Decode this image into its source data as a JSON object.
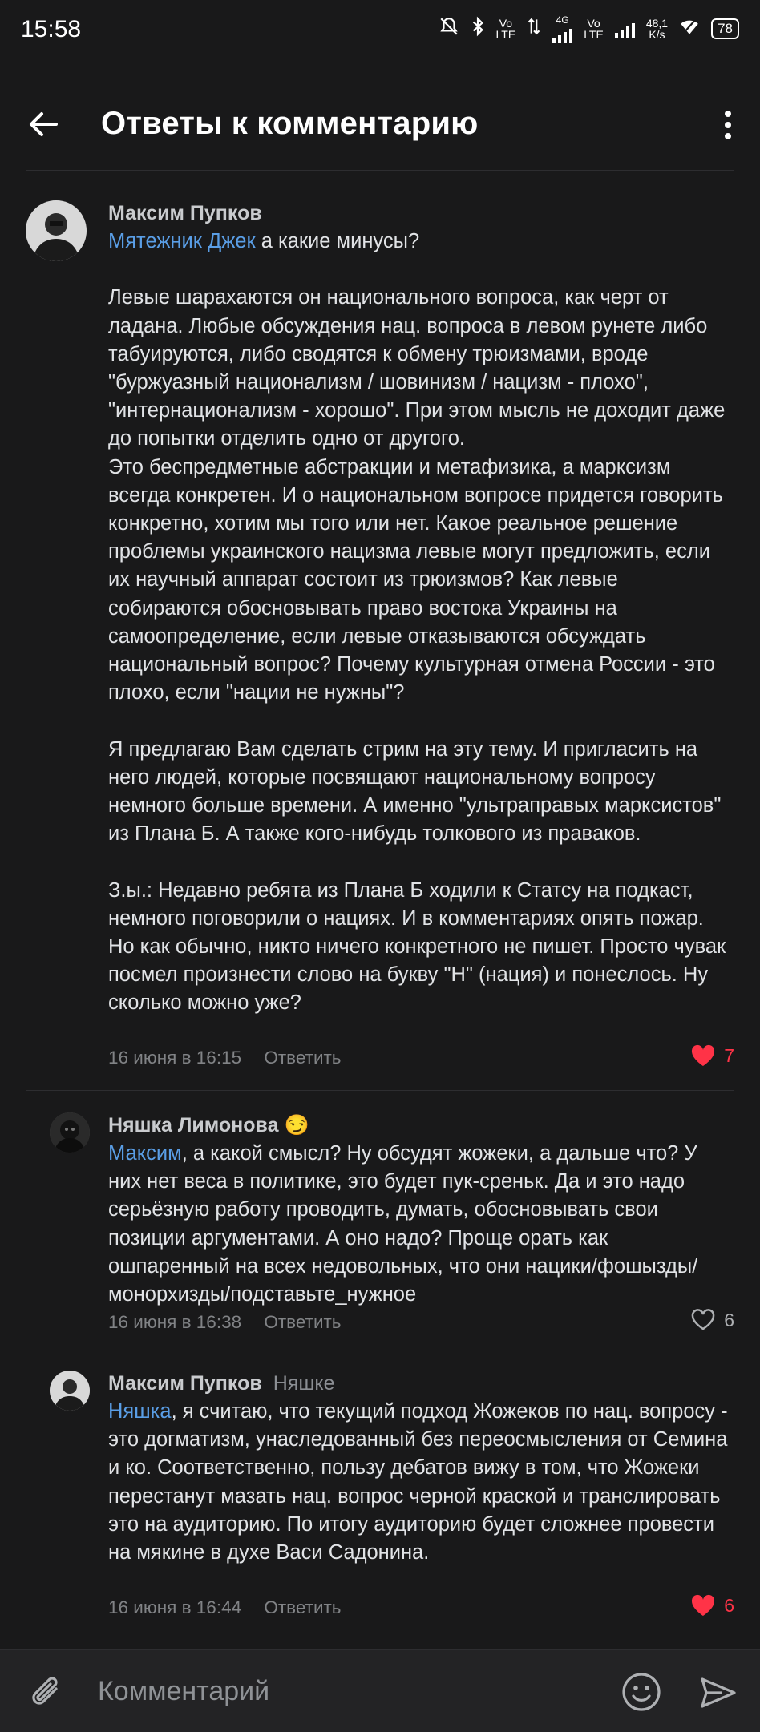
{
  "status_bar": {
    "time": "15:58",
    "net_top": "Vo",
    "net_bottom": "LTE",
    "net_gen": "4G",
    "net2_top": "Vo",
    "net2_bottom": "LTE",
    "speed_value": "48,1",
    "speed_unit": "K/s",
    "battery": "78"
  },
  "header": {
    "title": "Ответы к комментарию"
  },
  "comments": [
    {
      "author": "Максим Пупков",
      "mention": "Мятежник Джек",
      "text": " а какие минусы?\n\nЛевые шарахаются он национального вопроса, как черт от ладана. Любые обсуждения нац. вопроса в левом рунете либо табуируются, либо сводятся к обмену трюизмами, вроде \"буржуазный национализм / шовинизм / нацизм - плохо\", \"интернационализм - хорошо\". При этом мысль не доходит даже до попытки отделить одно от другого.\nЭто беспредметные абстракции и метафизика, а марксизм всегда конкретен. И о национальном вопросе придется говорить конкретно, хотим мы того или нет. Какое реальное решение проблемы украинского нацизма левые могут предложить, если их научный аппарат состоит из трюизмов? Как левые собираются обосновывать право востока Украины на самоопределение, если левые отказываются обсуждать национальный вопрос? Почему культурная отмена России - это плохо, если \"нации не нужны\"?\n\nЯ предлагаю Вам сделать стрим на эту тему. И пригласить на него людей, которые посвящают национальному вопросу немного больше времени. А именно \"ультраправых марксистов\" из Плана Б. А также кого-нибудь толкового из правaков.\n\nЗ.ы.: Недавно ребята из Плана Б ходили к Статсу на подкаст, немного поговорили о нациях. И в комментариях опять пожар. Но как обычно, никто ничего конкретного не пишет. Просто чувак посмел произнести слово на букву \"Н\" (нация) и понеслось. Ну сколько можно уже?",
      "date": "16 июня в 16:15",
      "reply_label": "Ответить",
      "likes": "7",
      "liked": true
    },
    {
      "author": "Няшка Лимонова",
      "author_emoji": "😏",
      "mention": "Максим",
      "text": ", а какой смысл? Ну обсудят жожеки, а дальше что? У них нет веса в политике, это будет пук-среньк. Да и это надо серьёзную работу проводить, думать, обосновывать свои позиции аргументами. А оно надо? Проще орать как ошпаренный на всех недовольных, что они нацики/фошызды/монорхизды/подставьте_нужное",
      "date": "16 июня в 16:38",
      "reply_label": "Ответить",
      "likes": "6",
      "liked": false
    },
    {
      "author": "Максим Пупков",
      "reply_to": "Няшке",
      "mention": "Няшка",
      "text": ", я считаю, что текущий подход Жожеков по нац. вопросу - это догматизм, унаследованный без переосмысления от Семина и ко. Соответственно, пользу дебатов вижу в том, что Жожеки перестанут мазать нац. вопрос черной краской и транслировать это на аудиторию. По итогу аудиторию будет сложнее провести на мякине в духе Васи Садонина.",
      "date": "16 июня в 16:44",
      "reply_label": "Ответить",
      "likes": "6",
      "liked": true
    }
  ],
  "input": {
    "placeholder": "Комментарий"
  },
  "colors": {
    "background": "#19191a",
    "link": "#5a9ee6",
    "like_active": "#ff3347"
  }
}
